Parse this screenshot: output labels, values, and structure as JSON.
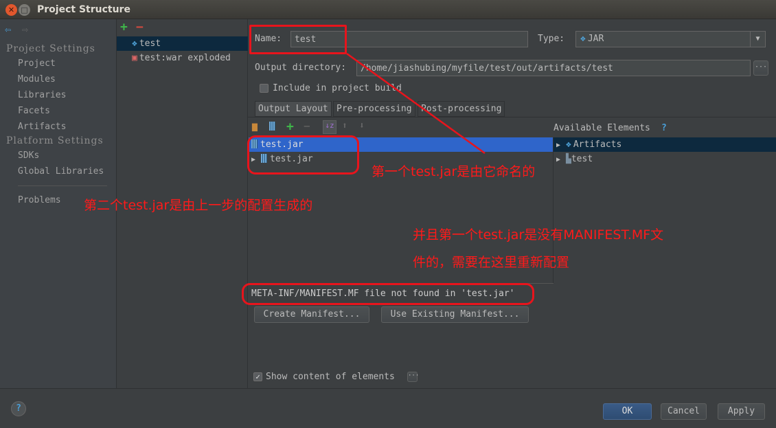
{
  "window": {
    "title": "Project Structure"
  },
  "sidebar": {
    "sections": [
      {
        "title": "Project Settings",
        "items": [
          "Project",
          "Modules",
          "Libraries",
          "Facets",
          "Artifacts"
        ]
      },
      {
        "title": "Platform Settings",
        "items": [
          "SDKs",
          "Global Libraries"
        ]
      }
    ],
    "problems": "Problems"
  },
  "tree": {
    "items": [
      "test",
      "test:war exploded"
    ]
  },
  "form": {
    "name_label": "Name:",
    "name_value": "test",
    "type_label": "Type:",
    "type_value": "JAR",
    "output_label": "Output directory:",
    "output_value": "/home/jiashubing/myfile/test/out/artifacts/test",
    "include_label": "Include in project build"
  },
  "tabs": [
    "Output Layout",
    "Pre-processing",
    "Post-processing"
  ],
  "layout": {
    "items": [
      "test.jar",
      "test.jar"
    ],
    "available_label": "Available Elements",
    "available": [
      "Artifacts",
      "test"
    ],
    "help": "?"
  },
  "manifest": {
    "message": "META-INF/MANIFEST.MF file not found in 'test.jar'",
    "create": "Create Manifest...",
    "existing": "Use Existing Manifest..."
  },
  "show_content": "Show content of elements",
  "buttons": {
    "ok": "OK",
    "cancel": "Cancel",
    "apply": "Apply",
    "help": "?"
  },
  "annotations": [
    "第一个test.jar是由它命名的",
    "第二个test.jar是由上一步的配置生成的",
    "并且第一个test.jar是没有MANIFEST.MF文",
    "件的，需要在这里重新配置"
  ],
  "colors": {
    "selection": "#2f65ca",
    "annotation": "#e8141c"
  }
}
